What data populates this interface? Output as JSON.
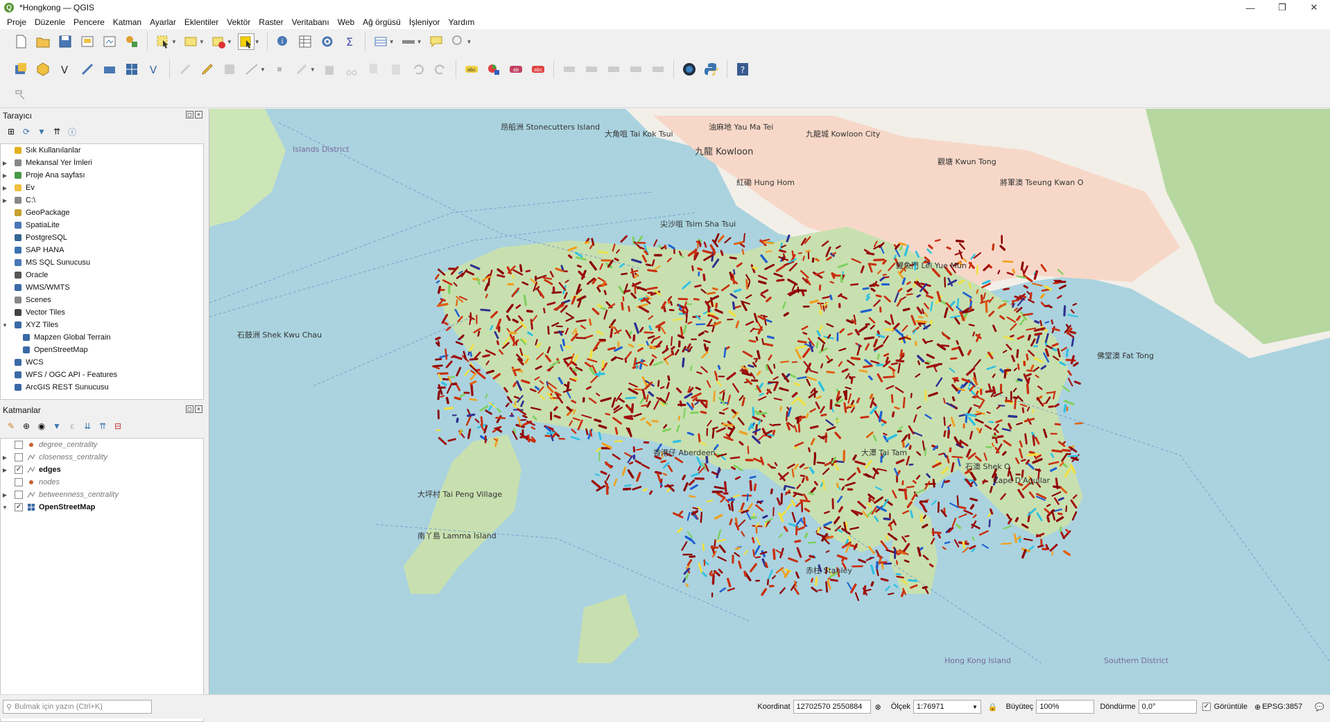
{
  "window": {
    "title": "*Hongkong — QGIS",
    "logo": "Q"
  },
  "menu": [
    "Proje",
    "Düzenle",
    "Pencere",
    "Katman",
    "Ayarlar",
    "Eklentiler",
    "Vektör",
    "Raster",
    "Veritabanı",
    "Web",
    "Ağ örgüsü",
    "İşleniyor",
    "Yardım"
  ],
  "browser": {
    "title": "Tarayıcı",
    "items": [
      {
        "label": "Sık Kullanılanlar",
        "icon": "star-icon"
      },
      {
        "label": "Mekansal Yer İmleri",
        "icon": "bookmark-icon"
      },
      {
        "label": "Proje Ana sayfası",
        "icon": "project-home-icon"
      },
      {
        "label": "Ev",
        "icon": "folder-icon"
      },
      {
        "label": "C:\\",
        "icon": "drive-icon"
      },
      {
        "label": "GeoPackage",
        "icon": "geopackage-icon"
      },
      {
        "label": "SpatiaLite",
        "icon": "spatialite-icon"
      },
      {
        "label": "PostgreSQL",
        "icon": "postgresql-icon"
      },
      {
        "label": "SAP HANA",
        "icon": "sap-hana-icon"
      },
      {
        "label": "MS SQL Sunucusu",
        "icon": "mssql-icon"
      },
      {
        "label": "Oracle",
        "icon": "oracle-icon"
      },
      {
        "label": "WMS/WMTS",
        "icon": "wms-icon"
      },
      {
        "label": "Scenes",
        "icon": "scenes-icon"
      },
      {
        "label": "Vector Tiles",
        "icon": "vector-tiles-icon"
      },
      {
        "label": "XYZ Tiles",
        "icon": "xyz-tiles-icon"
      },
      {
        "label": "Mapzen Global Terrain",
        "icon": "xyz-tiles-icon"
      },
      {
        "label": "OpenStreetMap",
        "icon": "xyz-tiles-icon"
      },
      {
        "label": "WCS",
        "icon": "wcs-icon"
      },
      {
        "label": "WFS / OGC API - Features",
        "icon": "wfs-icon"
      },
      {
        "label": "ArcGIS REST Sunucusu",
        "icon": "arcgis-icon"
      }
    ]
  },
  "layers": {
    "title": "Katmanlar",
    "items": [
      {
        "label": "degree_centrality",
        "checked": false
      },
      {
        "label": "closeness_centrality",
        "checked": false
      },
      {
        "label": "edges",
        "checked": true
      },
      {
        "label": "nodes",
        "checked": false
      },
      {
        "label": "betweenness_centrality",
        "checked": false
      },
      {
        "label": "OpenStreetMap",
        "checked": true
      }
    ]
  },
  "map": {
    "labels": [
      "九龍 Kowloon",
      "大角咀 Tai Kok Tsui",
      "尖沙咀 Tsim Sha Tsui",
      "油麻地 Yau Ma Tei",
      "紅磡 Hung Hom",
      "九龍城 Kowloon City",
      "觀塘 Kwun Tong",
      "將軍澳 Tseung Kwan O",
      "鯉魚門 Lei Yue Mun",
      "佛堂澳 Fat Tong",
      "香港仔 Aberdeen",
      "大潭 Tai Tam",
      "赤柱 Stanley",
      "石澳 Shek O",
      "南丫島 Lamma Island",
      "大坪村 Tai Peng Village",
      "昂船洲 Stonecutters Island",
      "石鼓洲 Shek Kwu Chau",
      "Hong Kong Island",
      "Southern District",
      "Cape D'Aguilar",
      "Islands District"
    ]
  },
  "status": {
    "search_placeholder": "Bulmak için yazın (Ctrl+K)",
    "coord_label": "Koordinat",
    "coord_value": "12702570  2550884",
    "scale_label": "Ölçek",
    "scale_value": "1:76971",
    "magnifier_label": "Büyüteç",
    "magnifier_value": "100%",
    "rotation_label": "Döndürme",
    "rotation_value": "0,0°",
    "render_label": "Görüntüle",
    "crs": "EPSG:3857"
  }
}
